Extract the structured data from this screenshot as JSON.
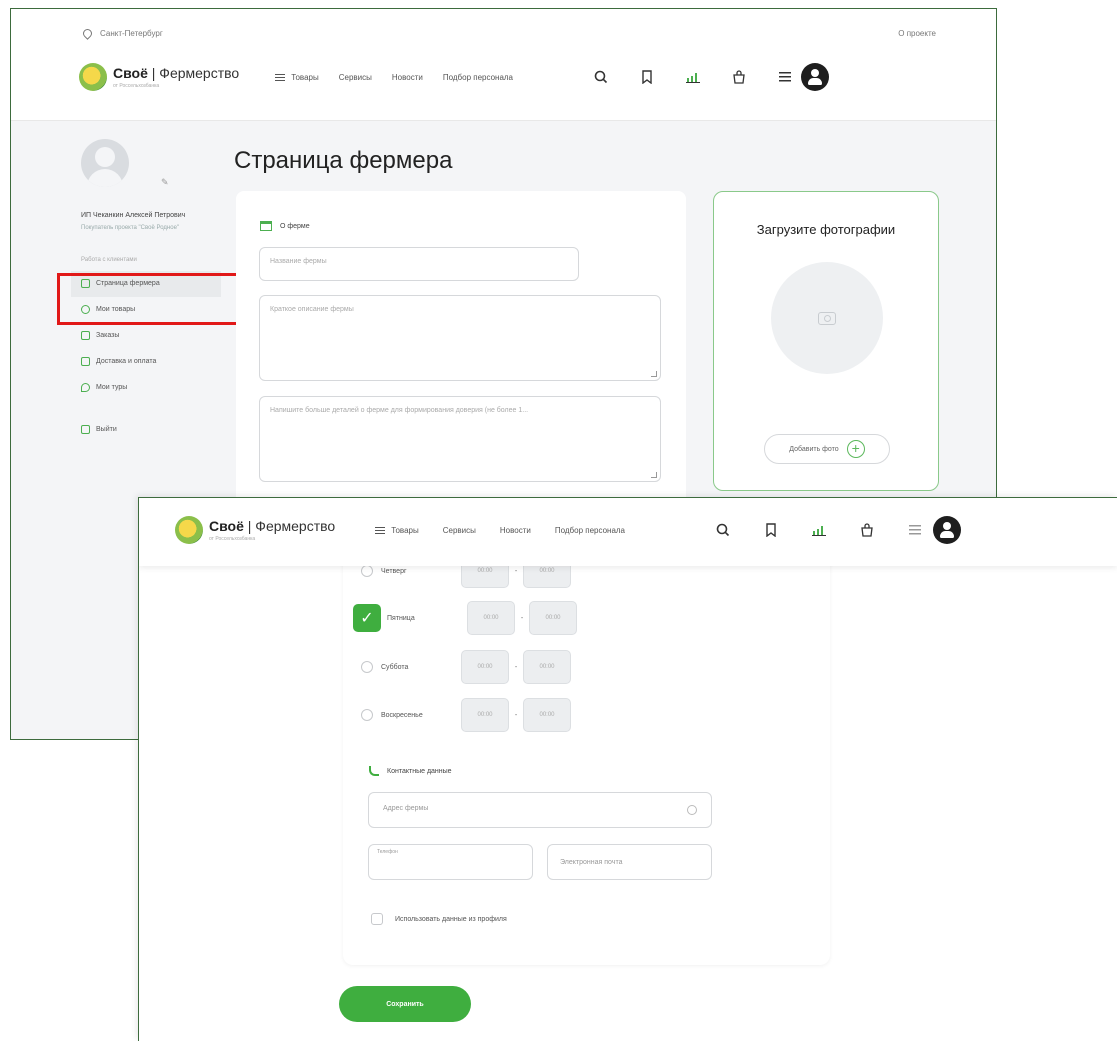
{
  "top_bar": {
    "city": "Санкт-Петербург",
    "about": "О проекте"
  },
  "logo": {
    "brand_bold": "Своё",
    "brand_light": "Фермерство",
    "tagline": "от Россельхозбанка"
  },
  "nav": {
    "items": [
      "Товары",
      "Сервисы",
      "Новости",
      "Подбор персонала"
    ]
  },
  "header_icons": [
    "search-icon",
    "bookmark-icon",
    "stats-icon",
    "basket-icon",
    "grid-menu-icon",
    "user-avatar-icon"
  ],
  "profile": {
    "name": "ИП Чеканкин Алексей Петрович",
    "role": "Покупатель проекта \"Своё Родное\""
  },
  "sidebar": {
    "section_title": "Работа с клиентами",
    "items": [
      {
        "label": "Страница фермера",
        "icon": "farm-page-icon",
        "active": true
      },
      {
        "label": "Мои товары",
        "icon": "products-icon",
        "active": false
      },
      {
        "label": "Заказы",
        "icon": "orders-icon",
        "active": false
      },
      {
        "label": "Доставка и оплата",
        "icon": "delivery-icon",
        "active": false
      },
      {
        "label": "Мои туры",
        "icon": "tours-icon",
        "active": false
      }
    ],
    "logout": "Выйти"
  },
  "page": {
    "title": "Страница фермера"
  },
  "about_farm": {
    "section_title": "О ферме",
    "name_placeholder": "Название фермы",
    "short_desc_placeholder": "Краткое описание фермы",
    "details_placeholder": "Напишите больше деталей о ферме для формирования доверия (не более 1..."
  },
  "photos": {
    "title": "Загрузите фотографии",
    "add_button": "Добавить фото"
  },
  "schedule": {
    "days": [
      {
        "name": "Четверг",
        "checked": false,
        "from": "00:00",
        "to": "00:00"
      },
      {
        "name": "Пятница",
        "checked": true,
        "from": "00:00",
        "to": "00:00"
      },
      {
        "name": "Суббота",
        "checked": false,
        "from": "00:00",
        "to": "00:00"
      },
      {
        "name": "Воскресенье",
        "checked": false,
        "from": "00:00",
        "to": "00:00"
      }
    ]
  },
  "contacts": {
    "section_title": "Контактные данные",
    "address_placeholder": "Адрес фермы",
    "phone_label": "Телефон",
    "email_placeholder": "Электронная почта",
    "use_profile_label": "Использовать данные из профиля"
  },
  "actions": {
    "save": "Сохранить"
  },
  "colors": {
    "accent": "#3fae3f",
    "highlight": "#e11818",
    "frame": "#3d6b3d"
  }
}
